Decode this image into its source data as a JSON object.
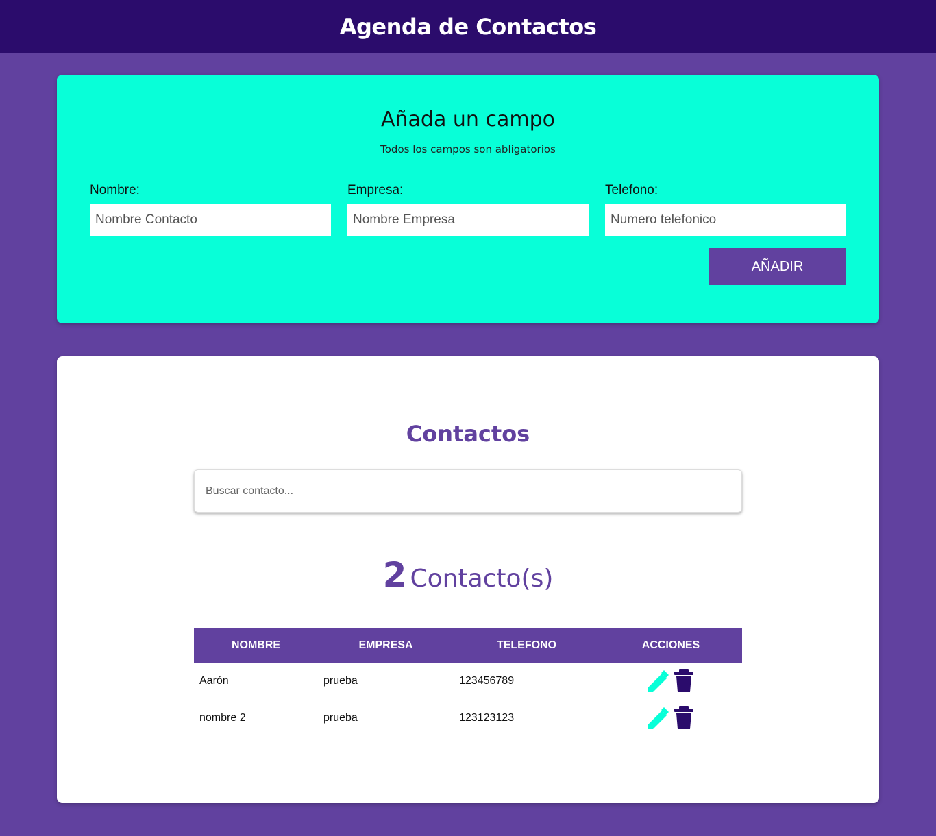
{
  "header": {
    "title": "Agenda de Contactos"
  },
  "form": {
    "title": "Añada un campo",
    "subtitle": "Todos los campos son abligatorios",
    "fields": [
      {
        "label": "Nombre:",
        "placeholder": "Nombre Contacto"
      },
      {
        "label": "Empresa:",
        "placeholder": "Nombre Empresa"
      },
      {
        "label": "Telefono:",
        "placeholder": "Numero telefonico"
      }
    ],
    "submit_label": "AÑADIR"
  },
  "contacts": {
    "title": "Contactos",
    "search_placeholder": "Buscar contacto...",
    "count": "2",
    "count_label": "Contacto(s)",
    "table": {
      "headers": [
        "NOMBRE",
        "EMPRESA",
        "TELEFONO",
        "ACCIONES"
      ],
      "rows": [
        {
          "nombre": "Aarón",
          "empresa": "prueba",
          "telefono": "123456789"
        },
        {
          "nombre": "nombre 2",
          "empresa": "prueba",
          "telefono": "123123123"
        }
      ]
    }
  },
  "icons": {
    "edit": "pencil-icon",
    "delete": "trash-icon"
  },
  "colors": {
    "header_bg": "#2b0c6c",
    "page_bg": "#61419f",
    "accent_teal": "#08ffd8",
    "primary": "#61419f"
  }
}
